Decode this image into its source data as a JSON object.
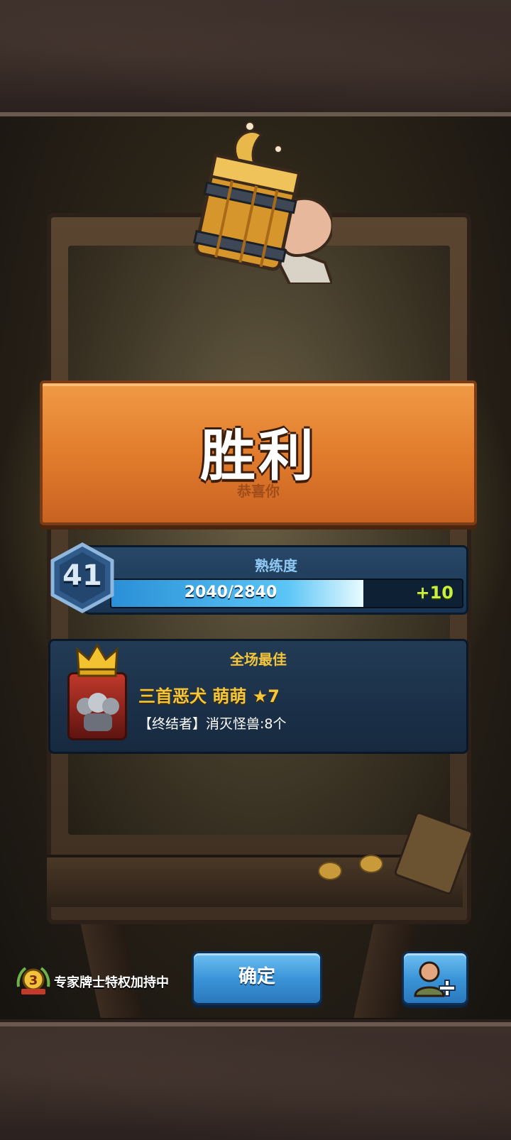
{
  "banner": {
    "title": "胜利",
    "subtitle": "恭喜你"
  },
  "proficiency": {
    "label": "熟练度",
    "level": "41",
    "progress_text": "2040/2840",
    "progress_fraction": 0.718,
    "gain": "+10"
  },
  "best": {
    "label": "全场最佳",
    "hero_name": "三首恶犬 萌萌 ★7",
    "hero_desc": "【终结者】消灭怪兽:8个"
  },
  "footer": {
    "privilege_text": "专家牌士特权加持中",
    "privilege_badge_number": "3",
    "confirm_label": "确定"
  },
  "colors": {
    "banner_orange": "#e07a2b",
    "panel_blue": "#1c3a57",
    "gold_text": "#f5c53a",
    "gain_green": "#c8f03c",
    "button_blue": "#3b95d8"
  },
  "icons": [
    "beer-mug-icon",
    "crown-icon",
    "expert-badge-icon",
    "add-friend-icon"
  ]
}
